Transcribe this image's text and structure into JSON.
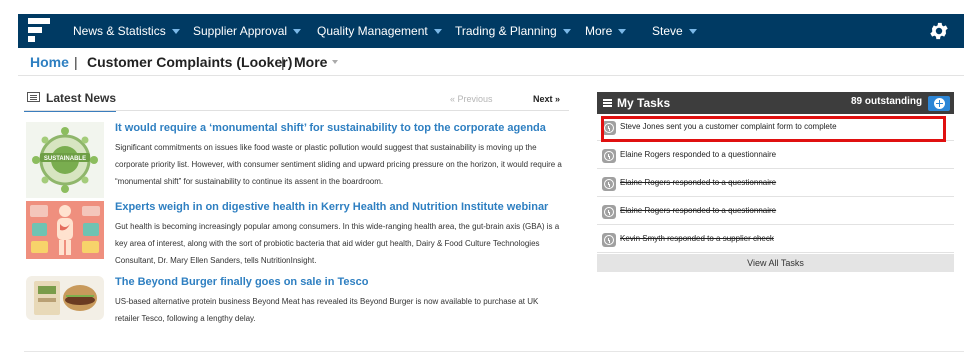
{
  "nav": {
    "items": [
      "News & Statistics",
      "Supplier Approval",
      "Quality Management",
      "Trading & Planning",
      "More",
      "Steve"
    ],
    "icons": {
      "logo": "app-logo-icon",
      "settings": "gear-icon"
    },
    "colors": {
      "bar": "#003a63",
      "caret": "#7ab8e8"
    }
  },
  "breadcrumb": {
    "home": "Home",
    "separator": "|",
    "current": "Customer Complaints (Looker)",
    "more": "More"
  },
  "news": {
    "tab_label": "Latest News",
    "prev_label": "« Previous",
    "next_label": "Next »",
    "articles": [
      {
        "title": "It would require a ‘monumental shift’ for sustainability to top the corporate agenda",
        "body": "Significant commitments on issues like food waste or plastic pollution would suggest that sustainability is moving up the corporate priority list. However, with consumer sentiment sliding and upward pricing pressure on the horizon, it would require a “monumental shift” for sustainability to continue its assent in the boardroom.",
        "thumb_text": "SUSTAINABLE"
      },
      {
        "title": "Experts weigh in on digestive health in Kerry Health and Nutrition Institute webinar",
        "body": "Gut health is becoming increasingly popular among consumers. In this wide-ranging health area, the gut-brain axis (GBA) is a key area of interest, along with the sort of probiotic bacteria that aid wider gut health, Dairy & Food Culture Technologies Consultant, Dr. Mary Ellen Sanders, tells NutritionInsight."
      },
      {
        "title": "The Beyond Burger finally goes on sale in Tesco",
        "body": "US-based alternative protein business Beyond Meat has revealed its Beyond Burger is now available to purchase at UK retailer Tesco, following a lengthy delay."
      }
    ]
  },
  "tasks": {
    "title": "My Tasks",
    "outstanding": "89 outstanding",
    "items": [
      {
        "text": "Steve Jones sent you a customer complaint form to complete",
        "done": false
      },
      {
        "text": "Elaine Rogers responded to a questionnaire",
        "done": false
      },
      {
        "text": "Elaine Rogers responded to a questionnaire",
        "done": true
      },
      {
        "text": "Elaine Rogers responded to a questionnaire",
        "done": true
      },
      {
        "text": "Kevin Smyth responded to a supplier check",
        "done": true
      }
    ],
    "view_all": "View All Tasks",
    "colors": {
      "header": "#3d3d3d",
      "add_button": "#2d86d6",
      "highlight": "#e01010"
    }
  }
}
